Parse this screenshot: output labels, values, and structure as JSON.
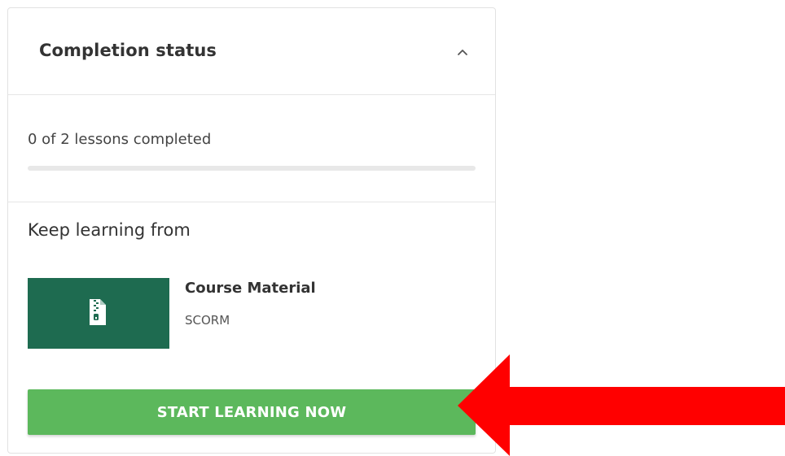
{
  "completion_card": {
    "title": "Completion status",
    "collapse_icon": "chevron-up-icon",
    "progress": {
      "text": "0 of 2 lessons completed",
      "completed": 0,
      "total": 2,
      "fraction": 0
    },
    "keep_learning": {
      "title": "Keep learning from",
      "item": {
        "name": "Course Material",
        "type": "SCORM",
        "icon": "zip-file-icon"
      }
    },
    "start_button_label": "START LEARNING NOW"
  },
  "annotation": {
    "icon": "arrow-left-icon",
    "color": "#ff0000"
  },
  "colors": {
    "accent": "#5cb85c",
    "thumbnail": "#1e6b50"
  }
}
